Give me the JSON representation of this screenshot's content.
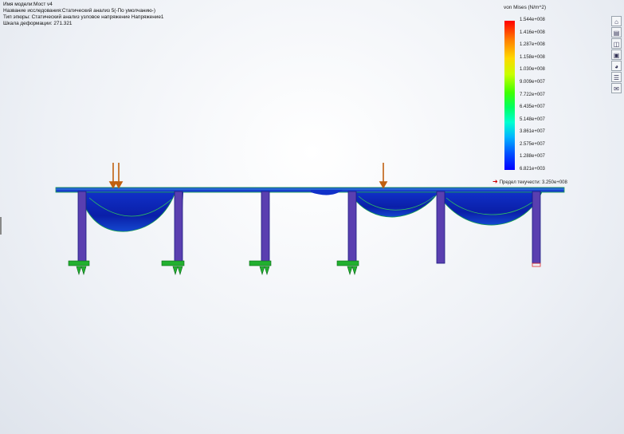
{
  "info": {
    "model_name": "Имя модели:Мост v4",
    "study_name": "Название исследования:Статический анализ 5(-По умолчанию-)",
    "plot_type": "Тип эпюры: Статический анализ узловое напряжение Напряжение1",
    "deformation_scale": "Шкала деформации: 271.321"
  },
  "legend": {
    "title": "von Mises (N/m^2)",
    "labels": [
      "1.544e+008",
      "1.416e+008",
      "1.287e+008",
      "1.158e+008",
      "1.030e+008",
      "9.009e+007",
      "7.722e+007",
      "6.435e+007",
      "5.148e+007",
      "3.861e+007",
      "2.575e+007",
      "1.288e+007",
      "6.821e+003"
    ],
    "yield_text": "Предел текучести: 3.250e+008",
    "yield_arrow_color": "#d00000"
  },
  "toolbar": {
    "icons": [
      "home-icon",
      "study-icon",
      "folder-icon",
      "display-icon",
      "appearance-icon",
      "list-icon",
      "report-icon"
    ]
  },
  "colors": {
    "beam": "#1a3fcc",
    "beam_edge": "#18a050",
    "load_arrow": "#c06010",
    "fixture": "#22b030"
  }
}
